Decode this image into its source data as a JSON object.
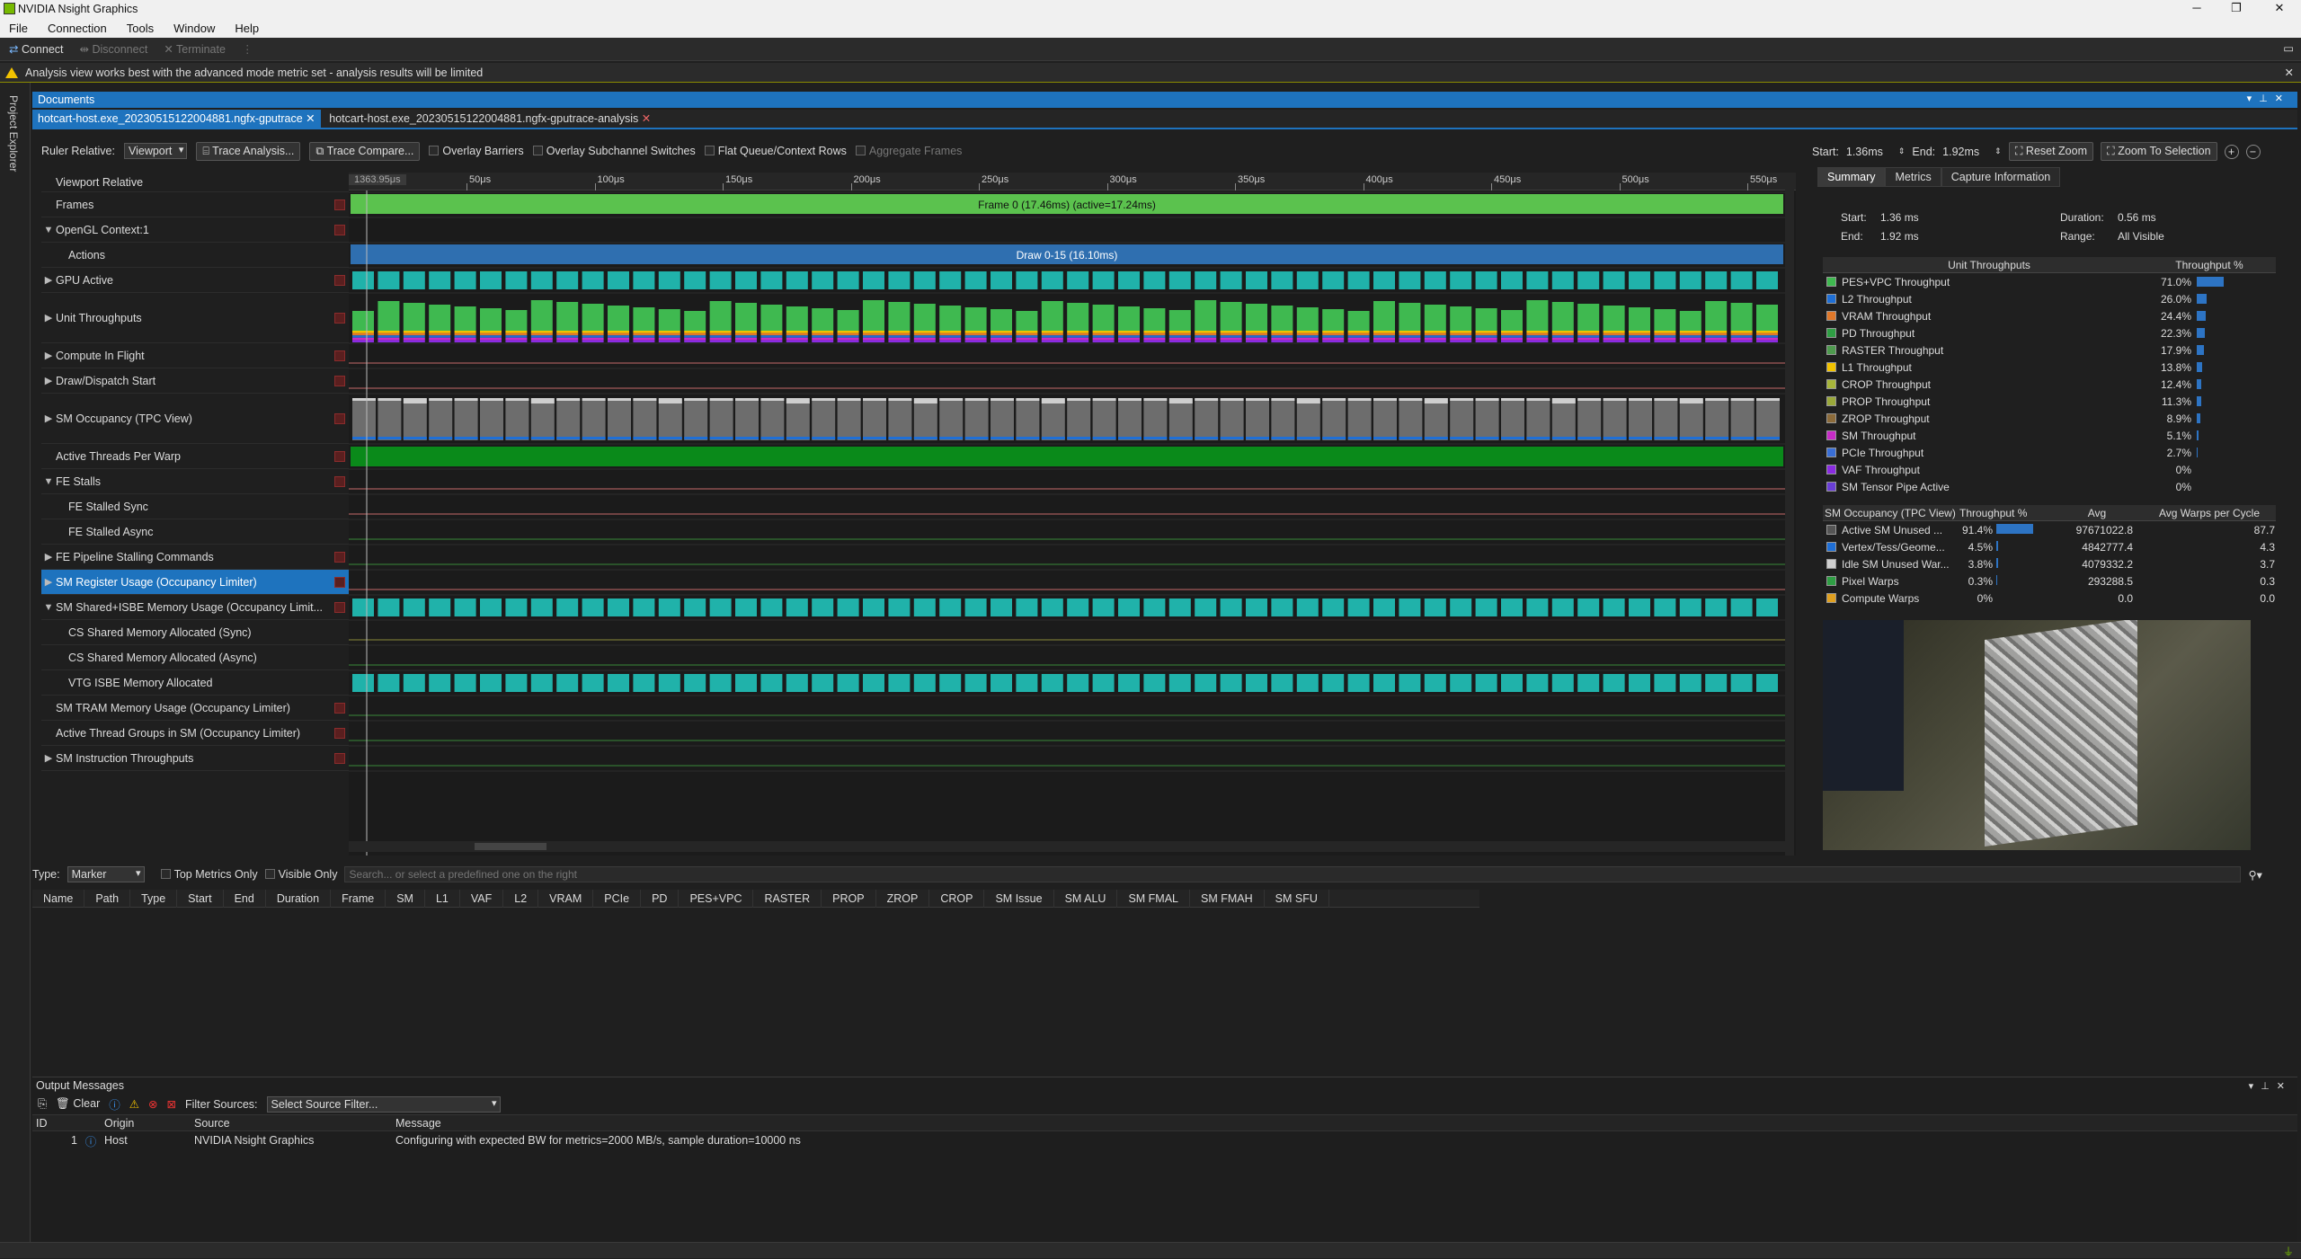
{
  "app": {
    "title": "NVIDIA Nsight Graphics",
    "window_buttons": [
      "─",
      "❐",
      "✕"
    ]
  },
  "menu": [
    "File",
    "Connection",
    "Tools",
    "Window",
    "Help"
  ],
  "toolbar": {
    "connect": "Connect",
    "disconnect": "Disconnect",
    "terminate": "Terminate"
  },
  "warning": "Analysis view works best with the advanced mode metric set - analysis results will be limited",
  "side_panel": "Project Explorer",
  "documents_title": "Documents",
  "doc_tabs": [
    {
      "label": "hotcart-host.exe_20230515122004881.ngfx-gputrace",
      "active": true
    },
    {
      "label": "hotcart-host.exe_20230515122004881.ngfx-gputrace-analysis",
      "active": false
    }
  ],
  "trace_bar": {
    "ruler_relative_label": "Ruler Relative:",
    "ruler_relative_value": "Viewport",
    "trace_analysis": "Trace Analysis...",
    "trace_compare": "Trace Compare...",
    "overlay_barriers": "Overlay Barriers",
    "overlay_subchannel": "Overlay Subchannel Switches",
    "flat_queue": "Flat Queue/Context Rows",
    "aggregate_frames": "Aggregate Frames",
    "start_label": "Start:",
    "start_value": "1.36ms",
    "end_label": "End:",
    "end_value": "1.92ms",
    "reset_zoom": "Reset Zoom",
    "zoom_to_selection": "Zoom To Selection"
  },
  "ruler": {
    "cursor": "1363.95μs",
    "ticks": [
      "50μs",
      "100μs",
      "150μs",
      "200μs",
      "250μs",
      "300μs",
      "350μs",
      "400μs",
      "450μs",
      "500μs",
      "550μs"
    ]
  },
  "rows": [
    {
      "label": "Viewport Relative",
      "indent": 0,
      "tri": "",
      "x": false
    },
    {
      "label": "Frames",
      "indent": 0,
      "tri": "",
      "x": true
    },
    {
      "label": "OpenGL Context:1",
      "indent": 0,
      "tri": "▼",
      "x": true
    },
    {
      "label": "Actions",
      "indent": 1,
      "tri": "",
      "x": false
    },
    {
      "label": "GPU Active",
      "indent": 0,
      "tri": "▶",
      "x": true
    },
    {
      "label": "Unit Throughputs",
      "indent": 0,
      "tri": "▶",
      "x": true
    },
    {
      "label": "Compute In Flight",
      "indent": 0,
      "tri": "▶",
      "x": true
    },
    {
      "label": "Draw/Dispatch Start",
      "indent": 0,
      "tri": "▶",
      "x": true
    },
    {
      "label": "SM Occupancy (TPC View)",
      "indent": 0,
      "tri": "▶",
      "x": true
    },
    {
      "label": "Active Threads Per Warp",
      "indent": 0,
      "tri": "",
      "x": true
    },
    {
      "label": "FE Stalls",
      "indent": 0,
      "tri": "▼",
      "x": true
    },
    {
      "label": "FE Stalled Sync",
      "indent": 1,
      "tri": "",
      "x": false
    },
    {
      "label": "FE Stalled Async",
      "indent": 1,
      "tri": "",
      "x": false
    },
    {
      "label": "FE Pipeline Stalling Commands",
      "indent": 0,
      "tri": "▶",
      "x": true
    },
    {
      "label": "SM Register Usage (Occupancy Limiter)",
      "indent": 0,
      "tri": "▶",
      "x": true
    },
    {
      "label": "SM Shared+ISBE Memory Usage (Occupancy Limit...",
      "indent": 0,
      "tri": "▼",
      "x": true
    },
    {
      "label": "CS Shared Memory Allocated (Sync)",
      "indent": 1,
      "tri": "",
      "x": false
    },
    {
      "label": "CS Shared Memory Allocated (Async)",
      "indent": 1,
      "tri": "",
      "x": false
    },
    {
      "label": "VTG ISBE Memory Allocated",
      "indent": 1,
      "tri": "",
      "x": false
    },
    {
      "label": "SM TRAM Memory Usage (Occupancy Limiter)",
      "indent": 0,
      "tri": "",
      "x": true
    },
    {
      "label": "Active Thread Groups in SM (Occupancy Limiter)",
      "indent": 0,
      "tri": "",
      "x": true
    },
    {
      "label": "SM Instruction Throughputs",
      "indent": 0,
      "tri": "▶",
      "x": true
    }
  ],
  "timeline": {
    "frame_label": "Frame 0 (17.46ms) (active=17.24ms)",
    "draw_label": "Draw 0-15 (16.10ms)"
  },
  "summary": {
    "tabs": [
      "Summary",
      "Metrics",
      "Capture Information"
    ],
    "start_label": "Start:",
    "start": "1.36 ms",
    "end_label": "End:",
    "end": "1.92 ms",
    "duration_label": "Duration:",
    "duration": "0.56 ms",
    "range_label": "Range:",
    "range": "All Visible",
    "unit_header": "Unit Throughputs",
    "pct_header": "Throughput %",
    "units": [
      {
        "name": "PES+VPC Throughput",
        "value": "71.0%",
        "pct": 71.0,
        "color": "#3fb950"
      },
      {
        "name": "L2 Throughput",
        "value": "26.0%",
        "pct": 26.0,
        "color": "#1f6fd6"
      },
      {
        "name": "VRAM Throughput",
        "value": "24.4%",
        "pct": 24.4,
        "color": "#e0782a"
      },
      {
        "name": "PD Throughput",
        "value": "22.3%",
        "pct": 22.3,
        "color": "#2f9e44"
      },
      {
        "name": "RASTER Throughput",
        "value": "17.9%",
        "pct": 17.9,
        "color": "#4e9a4e"
      },
      {
        "name": "L1 Throughput",
        "value": "13.8%",
        "pct": 13.8,
        "color": "#f2c200"
      },
      {
        "name": "CROP Throughput",
        "value": "12.4%",
        "pct": 12.4,
        "color": "#a7b53a"
      },
      {
        "name": "PROP Throughput",
        "value": "11.3%",
        "pct": 11.3,
        "color": "#9aa83a"
      },
      {
        "name": "ZROP Throughput",
        "value": "8.9%",
        "pct": 8.9,
        "color": "#8c6b3a"
      },
      {
        "name": "SM Throughput",
        "value": "5.1%",
        "pct": 5.1,
        "color": "#c62cc6"
      },
      {
        "name": "PCIe Throughput",
        "value": "2.7%",
        "pct": 2.7,
        "color": "#3a6fd6"
      },
      {
        "name": "VAF Throughput",
        "value": "0%",
        "pct": 0,
        "color": "#8a2be2"
      },
      {
        "name": "SM Tensor Pipe Active",
        "value": "0%",
        "pct": 0,
        "color": "#6a3fd6"
      }
    ],
    "occ_headers": [
      "SM Occupancy (TPC View)",
      "Throughput %",
      "Avg",
      "Avg Warps per Cycle"
    ],
    "occupancy": [
      {
        "name": "Active SM Unused ...",
        "pct_text": "91.4%",
        "pct": 91.4,
        "avg": "97671022.8",
        "warps": "87.7",
        "color": "#555555"
      },
      {
        "name": "Vertex/Tess/Geome...",
        "pct_text": "4.5%",
        "pct": 4.5,
        "avg": "4842777.4",
        "warps": "4.3",
        "color": "#1f6fd6"
      },
      {
        "name": "Idle SM Unused War...",
        "pct_text": "3.8%",
        "pct": 3.8,
        "avg": "4079332.2",
        "warps": "3.7",
        "color": "#cfcfcf"
      },
      {
        "name": "Pixel Warps",
        "pct_text": "0.3%",
        "pct": 0.3,
        "avg": "293288.5",
        "warps": "0.3",
        "color": "#2f9e44"
      },
      {
        "name": "Compute Warps",
        "pct_text": "0%",
        "pct": 0,
        "avg": "0.0",
        "warps": "0.0",
        "color": "#e0a020"
      }
    ]
  },
  "filter_bar": {
    "type_label": "Type:",
    "type_value": "Marker",
    "top_metrics": "Top Metrics Only",
    "visible_only": "Visible Only",
    "search_placeholder": "Search... or select a predefined one on the right"
  },
  "grid_columns": [
    "Name",
    "Path",
    "Type",
    "Start",
    "End",
    "Duration",
    "Frame",
    "SM",
    "L1",
    "VAF",
    "L2",
    "VRAM",
    "PCIe",
    "PD",
    "PES+VPC",
    "RASTER",
    "PROP",
    "ZROP",
    "CROP",
    "SM Issue",
    "SM ALU",
    "SM FMAL",
    "SM FMAH",
    "SM SFU"
  ],
  "output": {
    "title": "Output Messages",
    "clear": "Clear",
    "filter_label": "Filter Sources:",
    "filter_value": "Select Source Filter...",
    "headers": [
      "ID",
      "Origin",
      "Source",
      "Message"
    ],
    "rows": [
      {
        "id": "1",
        "origin": "Host",
        "source": "NVIDIA Nsight Graphics",
        "message": "Configuring with expected BW for metrics=2000 MB/s, sample duration=10000 ns"
      }
    ]
  }
}
